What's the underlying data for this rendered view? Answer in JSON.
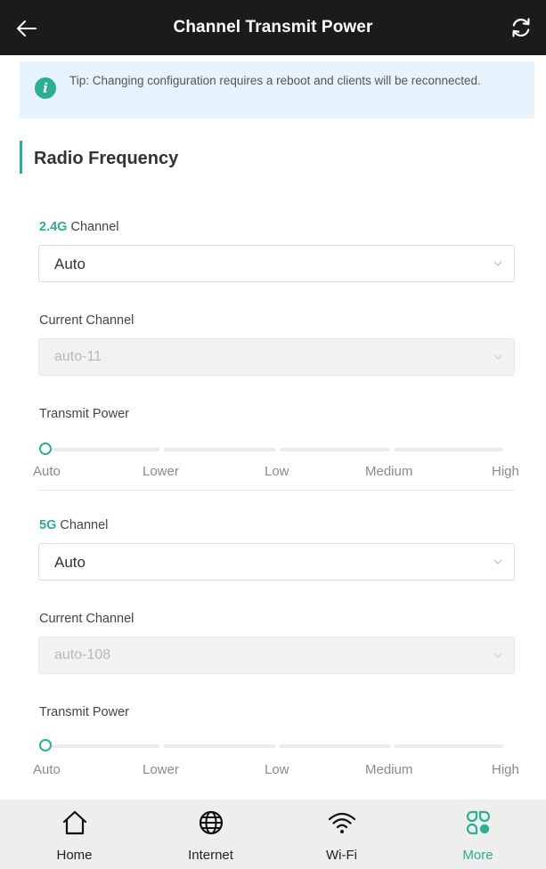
{
  "header": {
    "title": "Channel Transmit Power"
  },
  "tip": {
    "text": "Tip: Changing configuration requires a reboot and clients will be reconnected."
  },
  "section": {
    "title": "Radio Frequency"
  },
  "band_24": {
    "band": "2.4G",
    "channel_label": "Channel",
    "channel_value": "Auto",
    "current_label": "Current Channel",
    "current_value": "auto-11",
    "power_label": "Transmit Power",
    "power_level": "Auto"
  },
  "band_5": {
    "band": "5G",
    "channel_label": "Channel",
    "channel_value": "Auto",
    "current_label": "Current Channel",
    "current_value": "auto-108",
    "power_label": "Transmit Power",
    "power_level": "Auto"
  },
  "power_levels": [
    "Auto",
    "Lower",
    "Low",
    "Medium",
    "High"
  ],
  "tabs": [
    {
      "label": "Home",
      "icon": "home-icon",
      "active": false
    },
    {
      "label": "Internet",
      "icon": "globe-icon",
      "active": false
    },
    {
      "label": "Wi-Fi",
      "icon": "wifi-icon",
      "active": false
    },
    {
      "label": "More",
      "icon": "more-icon",
      "active": true
    }
  ],
  "colors": {
    "accent": "#2cae93",
    "header_bg": "#1b1b1b",
    "tip_bg": "#e6f3fc",
    "tabbar_bg": "#eeeeee"
  }
}
